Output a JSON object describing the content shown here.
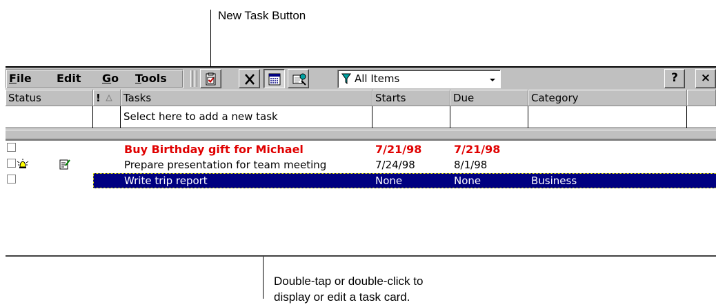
{
  "callouts": {
    "top": "New Task Button",
    "bottom_line1": "Double-tap or double-click to",
    "bottom_line2": "display or edit a task card."
  },
  "menu": {
    "file": {
      "u": "F",
      "rest": "ile"
    },
    "edit": "Edit",
    "go": {
      "u": "G",
      "rest": "o"
    },
    "tools": {
      "u": "T",
      "rest": "ools"
    }
  },
  "toolbar": {
    "filter_value": "All Items",
    "help_label": "?",
    "close_label": "×"
  },
  "columns": {
    "status": "Status",
    "priority": "!",
    "tasks": "Tasks",
    "starts": "Starts",
    "due": "Due",
    "category": "Category"
  },
  "new_task_placeholder": "Select here to add a new task",
  "tasks": [
    {
      "title": "Buy Birthday gift for Michael",
      "starts": "7/21/98",
      "due": "7/21/98",
      "category": ""
    },
    {
      "title": "Prepare presentation for team meeting",
      "starts": "7/24/98",
      "due": "8/1/98",
      "category": ""
    },
    {
      "title": "Write trip report",
      "starts": "None",
      "due": "None",
      "category": "Business"
    }
  ]
}
